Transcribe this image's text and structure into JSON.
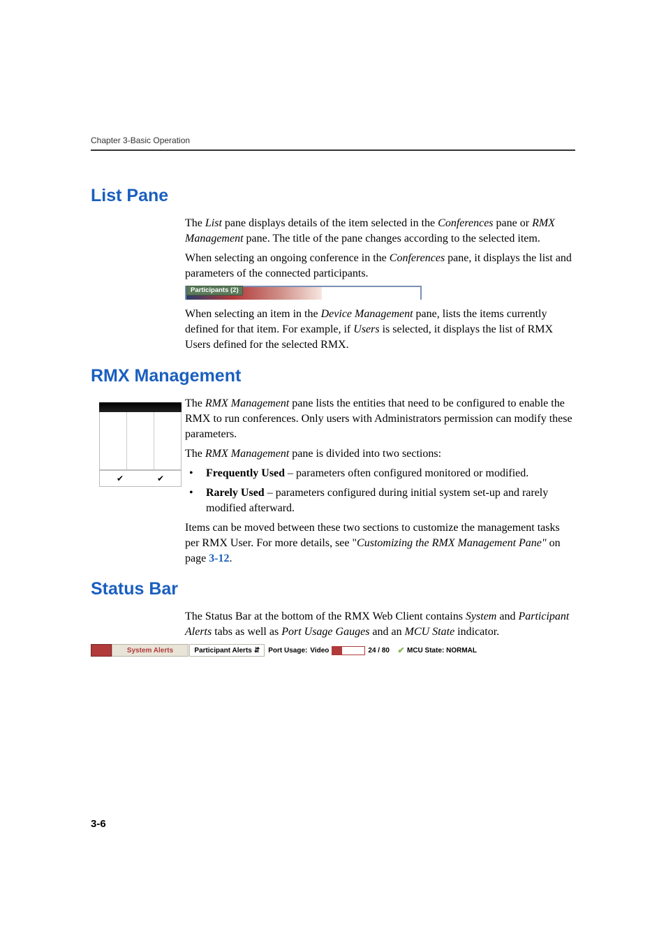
{
  "runningHeader": "Chapter 3-Basic Operation",
  "sections": {
    "listPane": {
      "heading": "List Pane",
      "p1_a": "The ",
      "p1_b": "List",
      "p1_c": " pane displays details of the item selected in the ",
      "p1_d": "Conferences",
      "p1_e": " pane or ",
      "p1_f": "RMX Management",
      "p1_g": " pane. The title of the pane changes according to the selected item.",
      "p2_a": "When selecting an ongoing conference in the ",
      "p2_b": "Conferences",
      "p2_c": " pane, it displays the list and parameters of the connected participants.",
      "tabLabel": "Participants (2)",
      "p3_a": "When selecting an item in the ",
      "p3_b": "Device Management",
      "p3_c": " pane, lists the items currently defined for that item. For example, if ",
      "p3_d": "Users",
      "p3_e": " is selected, it displays the list of RMX Users defined for the selected RMX."
    },
    "rmx": {
      "heading": "RMX Management",
      "p1_a": "The ",
      "p1_b": "RMX Management",
      "p1_c": " pane lists the entities that need to be configured to enable the RMX to run conferences. Only users with Administrators permission can modify these parameters.",
      "p2_a": "The ",
      "p2_b": "RMX Management",
      "p2_c": " pane is divided into two sections:",
      "bullet1_a": "Frequently Used",
      "bullet1_b": " – parameters often configured monitored or modified.",
      "bullet2_a": "Rarely Used",
      "bullet2_b": " – parameters configured during initial system set-up and rarely modified afterward.",
      "p3_a": "Items can be moved between these two sections to customize the management tasks per RMX User. For more details, see \"",
      "p3_b": "Customizing the RMX Management Pane\"",
      "p3_c": " on page ",
      "p3_link": "3-12",
      "p3_d": "."
    },
    "statusBar": {
      "heading": "Status Bar",
      "p1_a": "The Status Bar at the bottom of the RMX Web Client contains ",
      "p1_b": "System",
      "p1_c": " and ",
      "p1_d": "Participant Alerts",
      "p1_e": " tabs as well as ",
      "p1_f": "Port Usage Gauges",
      "p1_g": " and an ",
      "p1_h": "MCU State",
      "p1_i": " indicator.",
      "img": {
        "sysAlerts": "System Alerts",
        "partAlerts": "Participant Alerts",
        "portUsage": "Port Usage:",
        "video": "Video",
        "gaugeText": "24 / 80",
        "mcuState": "MCU State: NORMAL"
      }
    }
  },
  "pageNumber": "3-6"
}
